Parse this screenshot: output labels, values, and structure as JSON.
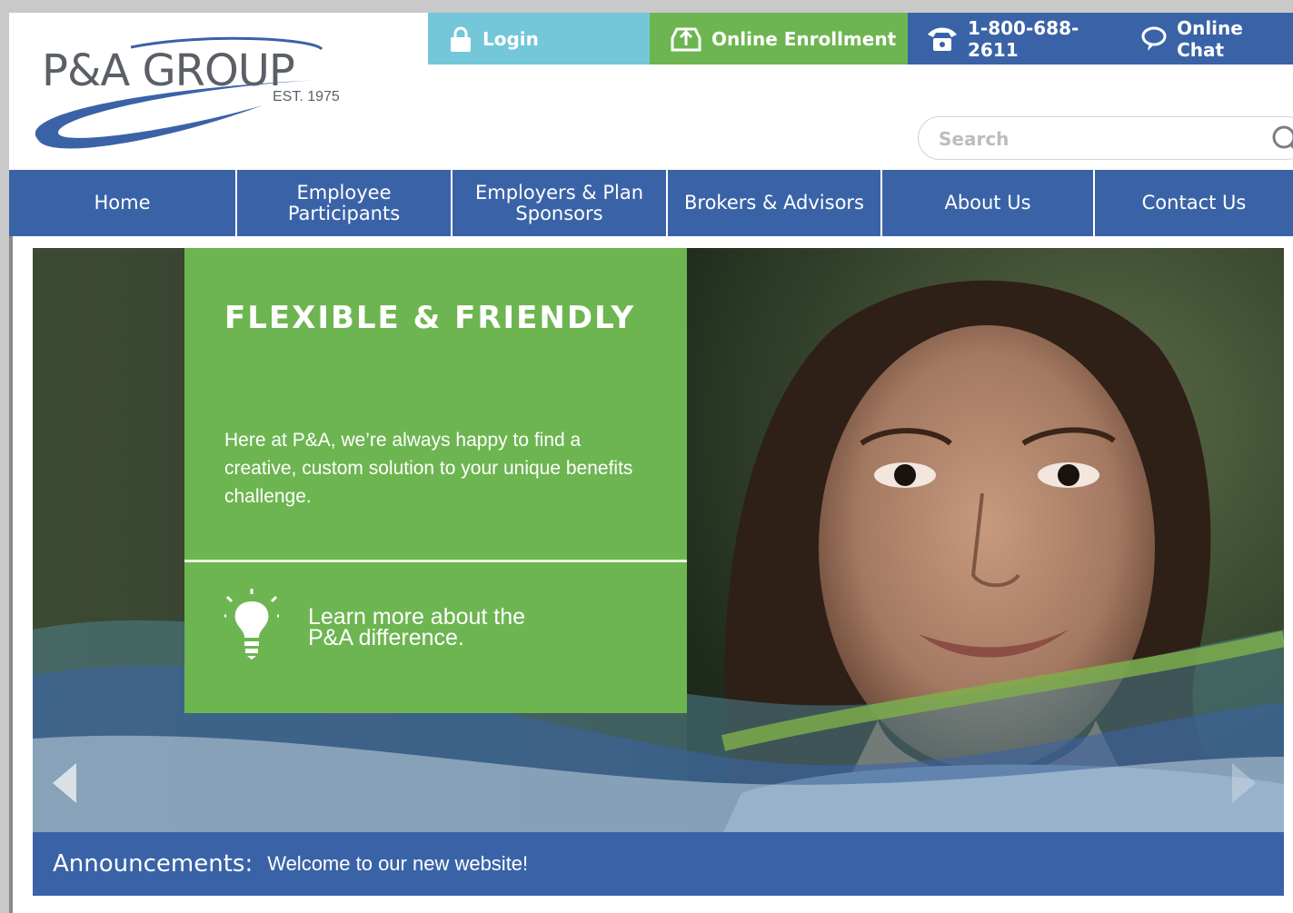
{
  "brand": {
    "name": "P&A GROUP",
    "est": "EST. 1975"
  },
  "topbar": {
    "login": "Login",
    "enrollment": "Online Enrollment",
    "phone": "1-800-688-2611",
    "chat": "Online Chat"
  },
  "search": {
    "placeholder": "Search"
  },
  "nav": {
    "items": [
      "Home",
      "Employee Participants",
      "Employers & Plan Sponsors",
      "Brokers & Advisors",
      "About Us",
      "Contact Us"
    ]
  },
  "hero": {
    "title": "FLEXIBLE & FRIENDLY",
    "body": "Here at P&A, we’re always happy to find a creative, custom solution to your unique benefits challenge.",
    "link": "Learn more about the P&A difference."
  },
  "announcement": {
    "label": "Announcements:",
    "message": "Welcome to our new website!"
  },
  "colors": {
    "blue": "#3a63a7",
    "green": "#6db551",
    "teal": "#73c7d9"
  }
}
